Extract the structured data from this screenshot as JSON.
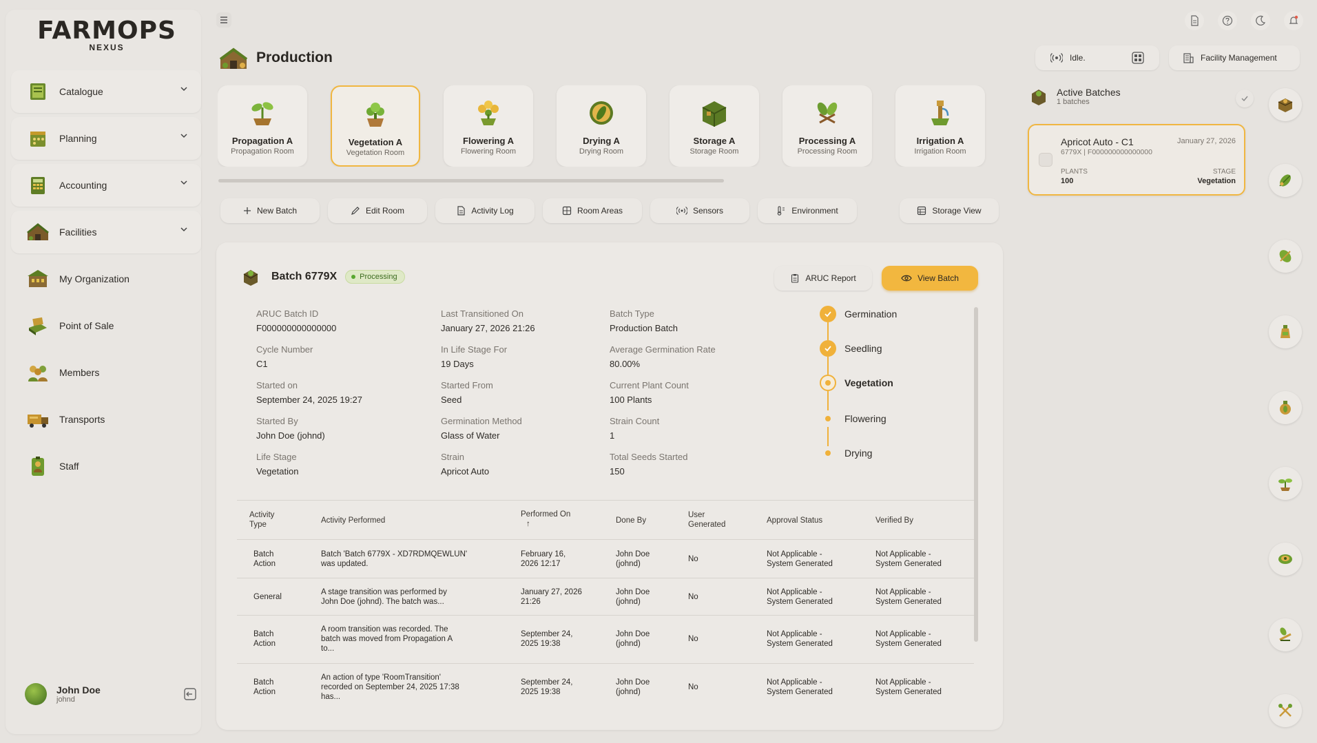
{
  "brand": {
    "name": "FARMOPS",
    "sub": "NEXUS"
  },
  "sidebar": {
    "items": [
      {
        "label": "Catalogue",
        "icon": "catalogue-icon",
        "expandable": true
      },
      {
        "label": "Planning",
        "icon": "planning-icon",
        "expandable": true
      },
      {
        "label": "Accounting",
        "icon": "accounting-icon",
        "expandable": true
      },
      {
        "label": "Facilities",
        "icon": "facilities-icon",
        "expandable": true
      },
      {
        "label": "My Organization",
        "icon": "organization-icon",
        "expandable": false
      },
      {
        "label": "Point of Sale",
        "icon": "point-of-sale-icon",
        "expandable": false
      },
      {
        "label": "Members",
        "icon": "members-icon",
        "expandable": false
      },
      {
        "label": "Transports",
        "icon": "transports-icon",
        "expandable": false
      },
      {
        "label": "Staff",
        "icon": "staff-icon",
        "expandable": false
      }
    ]
  },
  "user": {
    "name": "John Doe",
    "handle": "johnd"
  },
  "header": {
    "title": "Production"
  },
  "topbar": {
    "status_label": "Idle.",
    "facility_button": "Facility Management"
  },
  "rooms": [
    {
      "name": "Propagation A",
      "type": "Propagation Room",
      "active": false
    },
    {
      "name": "Vegetation A",
      "type": "Vegetation Room",
      "active": true
    },
    {
      "name": "Flowering A",
      "type": "Flowering Room",
      "active": false
    },
    {
      "name": "Drying A",
      "type": "Drying Room",
      "active": false
    },
    {
      "name": "Storage A",
      "type": "Storage Room",
      "active": false
    },
    {
      "name": "Processing A",
      "type": "Processing Room",
      "active": false
    },
    {
      "name": "Irrigation A",
      "type": "Irrigation Room",
      "active": false
    }
  ],
  "actions": {
    "new_batch": "New Batch",
    "edit_room": "Edit Room",
    "activity_log": "Activity Log",
    "room_areas": "Room Areas",
    "sensors": "Sensors",
    "environment": "Environment",
    "storage_view": "Storage View"
  },
  "batch": {
    "title": "Batch 6779X",
    "status": "Processing",
    "aruc_button": "ARUC Report",
    "view_button": "View Batch",
    "fields": {
      "aruc_batch_id": {
        "label": "ARUC Batch ID",
        "value": "F000000000000000"
      },
      "cycle_number": {
        "label": "Cycle Number",
        "value": "C1"
      },
      "started_on": {
        "label": "Started on",
        "value": "September 24, 2025 19:27"
      },
      "started_by": {
        "label": "Started By",
        "value": "John Doe (johnd)"
      },
      "life_stage": {
        "label": "Life Stage",
        "value": "Vegetation"
      },
      "last_transitioned": {
        "label": "Last Transitioned On",
        "value": "January 27, 2026 21:26"
      },
      "in_life_stage_for": {
        "label": "In Life Stage For",
        "value": "19 Days"
      },
      "started_from": {
        "label": "Started From",
        "value": "Seed"
      },
      "germination_method": {
        "label": "Germination Method",
        "value": "Glass of Water"
      },
      "strain": {
        "label": "Strain",
        "value": "Apricot Auto"
      },
      "batch_type": {
        "label": "Batch Type",
        "value": "Production Batch"
      },
      "avg_germination": {
        "label": "Average Germination Rate",
        "value": "80.00%"
      },
      "plant_count": {
        "label": "Current Plant Count",
        "value": "100 Plants"
      },
      "strain_count": {
        "label": "Strain Count",
        "value": "1"
      },
      "seeds_started": {
        "label": "Total Seeds Started",
        "value": "150"
      }
    },
    "stages": [
      {
        "label": "Germination",
        "state": "done"
      },
      {
        "label": "Seedling",
        "state": "done"
      },
      {
        "label": "Vegetation",
        "state": "current"
      },
      {
        "label": "Flowering",
        "state": "todo"
      },
      {
        "label": "Drying",
        "state": "todo"
      }
    ]
  },
  "activity_table": {
    "headers": {
      "type_1": "Activity",
      "type_2": "Type",
      "performed": "Activity Performed",
      "on_1": "Performed On",
      "on_arrow": "↑",
      "done_by": "Done By",
      "user_gen_1": "User",
      "user_gen_2": "Generated",
      "approval": "Approval Status",
      "verified": "Verified By"
    },
    "rows": [
      {
        "type_1": "Batch",
        "type_2": "Action",
        "act_1": "Batch 'Batch 6779X - XD7RDMQEWLUN'",
        "act_2": "was updated.",
        "act_3": "",
        "on_1": "February 16,",
        "on_2": "2026 12:17",
        "by_1": "John Doe",
        "by_2": "(johnd)",
        "user": "No",
        "ap_1": "Not Applicable -",
        "ap_2": "System Generated",
        "vb_1": "Not Applicable -",
        "vb_2": "System Generated"
      },
      {
        "type_1": "General",
        "type_2": "",
        "act_1": "A stage transition was performed by",
        "act_2": "John Doe (johnd). The batch was...",
        "act_3": "",
        "on_1": "January 27, 2026",
        "on_2": "21:26",
        "by_1": "John Doe",
        "by_2": "(johnd)",
        "user": "No",
        "ap_1": "Not Applicable -",
        "ap_2": "System Generated",
        "vb_1": "Not Applicable -",
        "vb_2": "System Generated"
      },
      {
        "type_1": "Batch",
        "type_2": "Action",
        "act_1": "A room transition was recorded. The",
        "act_2": "batch was moved from Propagation A",
        "act_3": "to...",
        "on_1": "September 24,",
        "on_2": "2025 19:38",
        "by_1": "John Doe",
        "by_2": "(johnd)",
        "user": "No",
        "ap_1": "Not Applicable -",
        "ap_2": "System Generated",
        "vb_1": "Not Applicable -",
        "vb_2": "System Generated"
      },
      {
        "type_1": "Batch",
        "type_2": "Action",
        "act_1": "An action of type 'RoomTransition'",
        "act_2": "recorded on September 24, 2025 17:38",
        "act_3": "has...",
        "on_1": "September 24,",
        "on_2": "2025 19:38",
        "by_1": "John Doe",
        "by_2": "(johnd)",
        "user": "No",
        "ap_1": "Not Applicable -",
        "ap_2": "System Generated",
        "vb_1": "Not Applicable -",
        "vb_2": "System Generated"
      }
    ]
  },
  "active_batches": {
    "title": "Active Batches",
    "count": "1 batches",
    "card": {
      "name": "Apricot Auto - C1",
      "date": "January 27, 2026",
      "id": "6779X | F000000000000000",
      "plants_label": "PLANTS",
      "plants_value": "100",
      "stage_label": "STAGE",
      "stage_value": "Vegetation"
    }
  },
  "colors": {
    "accent": "#f0b640",
    "background": "#e6e3df",
    "success": "#58a72f"
  }
}
